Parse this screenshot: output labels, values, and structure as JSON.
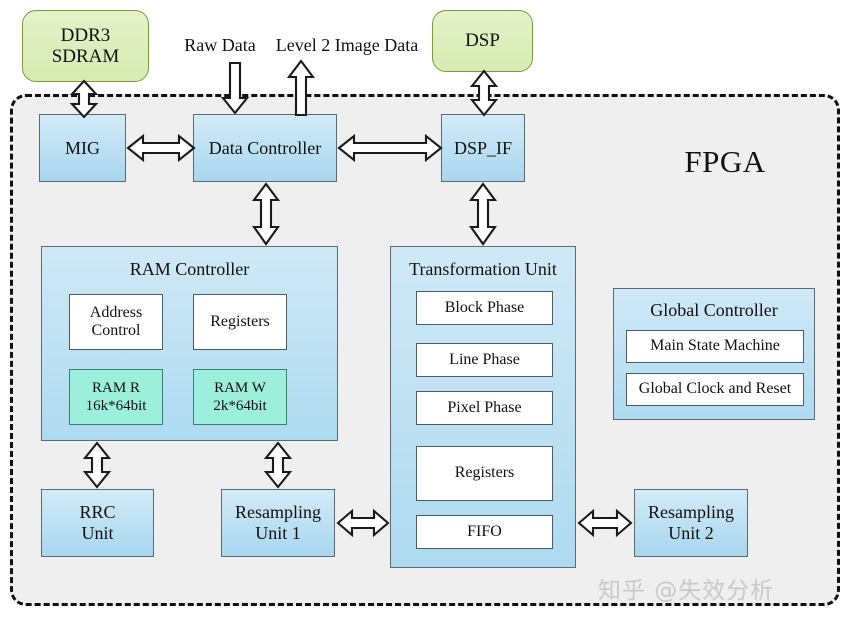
{
  "diagram": {
    "region_label": "FPGA",
    "watermark": "知乎 @失效分析",
    "external_blocks": [
      {
        "id": "ddr3",
        "label": "DDR3\nSDRAM"
      },
      {
        "id": "dsp",
        "label": "DSP"
      }
    ],
    "flow_labels": [
      {
        "id": "raw-data",
        "label": "Raw Data",
        "direction": "in"
      },
      {
        "id": "level2-image-data",
        "label": "Level 2 Image Data",
        "direction": "out"
      }
    ],
    "top_blocks": [
      {
        "id": "mig",
        "label": "MIG"
      },
      {
        "id": "data-controller",
        "label": "Data Controller"
      },
      {
        "id": "dsp-if",
        "label": "DSP_IF"
      }
    ],
    "ram_controller": {
      "title": "RAM Controller",
      "children": [
        {
          "id": "address-control",
          "label": "Address\nControl",
          "style": "white"
        },
        {
          "id": "registers",
          "label": "Registers",
          "style": "white"
        },
        {
          "id": "ram-r",
          "label": "RAM R\n16k*64bit",
          "style": "teal"
        },
        {
          "id": "ram-w",
          "label": "RAM W\n2k*64bit",
          "style": "teal"
        }
      ]
    },
    "transformation_unit": {
      "title": "Transformation Unit",
      "children": [
        {
          "id": "block-phase",
          "label": "Block  Phase"
        },
        {
          "id": "line-phase",
          "label": "Line Phase"
        },
        {
          "id": "pixel-phase",
          "label": "Pixel Phase"
        },
        {
          "id": "tu-registers",
          "label": "Registers"
        },
        {
          "id": "fifo",
          "label": "FIFO"
        }
      ]
    },
    "global_controller": {
      "title": "Global Controller",
      "children": [
        {
          "id": "main-state-machine",
          "label": "Main State Machine"
        },
        {
          "id": "global-clock-reset",
          "label": "Global Clock and Reset"
        }
      ]
    },
    "bottom_blocks": [
      {
        "id": "rrc-unit",
        "label": "RRC\nUnit"
      },
      {
        "id": "resampling-unit-1",
        "label": "Resampling\nUnit 1"
      },
      {
        "id": "resampling-unit-2",
        "label": "Resampling\nUnit 2"
      }
    ],
    "colors": {
      "external_fill": "#d7ebb2",
      "external_stroke": "#7b9a3e",
      "block_fill": "#a8d6ef",
      "block_stroke": "#5b6b72",
      "ram_fill": "#9cefdb",
      "ram_stroke": "#3d7f72",
      "region_fill": "#efefef",
      "region_stroke": "#111111",
      "arrow_fill": "#ffffff",
      "arrow_stroke": "#1a1a1a",
      "watermark": "#c9c9c9"
    }
  }
}
